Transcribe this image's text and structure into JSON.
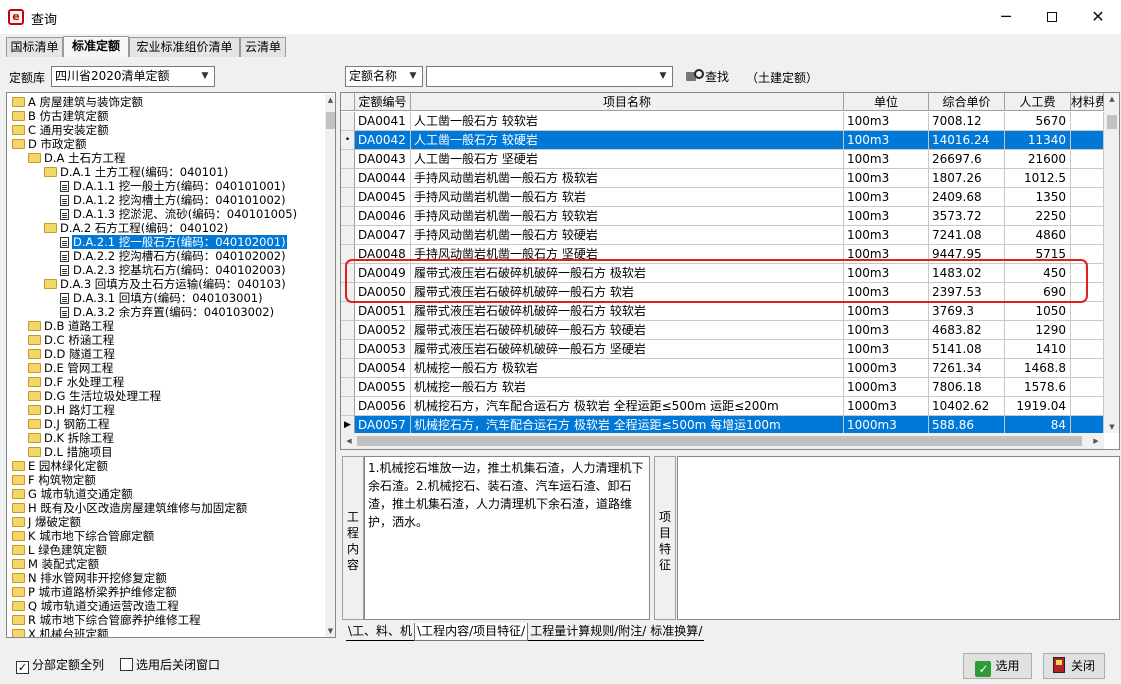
{
  "window": {
    "title": "查询",
    "icon": "app-logo-icon"
  },
  "top_tabs": [
    {
      "label": "国标清单",
      "active": false
    },
    {
      "label": "标准定额",
      "active": true
    },
    {
      "label": "宏业标准组价清单",
      "active": false
    },
    {
      "label": "云清单",
      "active": false
    }
  ],
  "filters": {
    "library_label": "定额库",
    "library_value": "四川省2020清单定额",
    "search_field_value": "定额名称",
    "search_input_value": "",
    "find_button_label": "查找",
    "scope_text": "（土建定额）"
  },
  "tree": [
    {
      "label": "A 房屋建筑与装饰定额",
      "indent": 0,
      "icon": "folder",
      "selected": false
    },
    {
      "label": "B 仿古建筑定额",
      "indent": 0,
      "icon": "folder",
      "selected": false
    },
    {
      "label": "C 通用安装定额",
      "indent": 0,
      "icon": "folder",
      "selected": false
    },
    {
      "label": "D 市政定额",
      "indent": 0,
      "icon": "folder",
      "selected": false
    },
    {
      "label": "D.A 土石方工程",
      "indent": 1,
      "icon": "folder",
      "selected": false
    },
    {
      "label": "D.A.1 土方工程(编码：040101)",
      "indent": 2,
      "icon": "folder",
      "selected": false
    },
    {
      "label": "D.A.1.1 挖一般土方(编码：040101001)",
      "indent": 3,
      "icon": "doc",
      "selected": false
    },
    {
      "label": "D.A.1.2 挖沟槽土方(编码：040101002)",
      "indent": 3,
      "icon": "doc",
      "selected": false
    },
    {
      "label": "D.A.1.3 挖淤泥、流砂(编码：040101005)",
      "indent": 3,
      "icon": "doc",
      "selected": false
    },
    {
      "label": "D.A.2 石方工程(编码：040102)",
      "indent": 2,
      "icon": "folder",
      "selected": false
    },
    {
      "label": "D.A.2.1 挖一般石方(编码：040102001)",
      "indent": 3,
      "icon": "doc",
      "selected": true
    },
    {
      "label": "D.A.2.2 挖沟槽石方(编码：040102002)",
      "indent": 3,
      "icon": "doc",
      "selected": false
    },
    {
      "label": "D.A.2.3 挖基坑石方(编码：040102003)",
      "indent": 3,
      "icon": "doc",
      "selected": false
    },
    {
      "label": "D.A.3 回填方及土石方运输(编码：040103)",
      "indent": 2,
      "icon": "folder",
      "selected": false
    },
    {
      "label": "D.A.3.1 回填方(编码：040103001)",
      "indent": 3,
      "icon": "doc",
      "selected": false
    },
    {
      "label": "D.A.3.2 余方弃置(编码：040103002)",
      "indent": 3,
      "icon": "doc",
      "selected": false
    },
    {
      "label": "D.B 道路工程",
      "indent": 1,
      "icon": "folder",
      "selected": false
    },
    {
      "label": "D.C 桥涵工程",
      "indent": 1,
      "icon": "folder",
      "selected": false
    },
    {
      "label": "D.D 隧道工程",
      "indent": 1,
      "icon": "folder",
      "selected": false
    },
    {
      "label": "D.E 管网工程",
      "indent": 1,
      "icon": "folder",
      "selected": false
    },
    {
      "label": "D.F 水处理工程",
      "indent": 1,
      "icon": "folder",
      "selected": false
    },
    {
      "label": "D.G 生活垃圾处理工程",
      "indent": 1,
      "icon": "folder",
      "selected": false
    },
    {
      "label": "D.H 路灯工程",
      "indent": 1,
      "icon": "folder",
      "selected": false
    },
    {
      "label": "D.J 钢筋工程",
      "indent": 1,
      "icon": "folder",
      "selected": false
    },
    {
      "label": "D.K 拆除工程",
      "indent": 1,
      "icon": "folder",
      "selected": false
    },
    {
      "label": "D.L 措施项目",
      "indent": 1,
      "icon": "folder",
      "selected": false
    },
    {
      "label": "E 园林绿化定额",
      "indent": 0,
      "icon": "folder",
      "selected": false
    },
    {
      "label": "F 构筑物定额",
      "indent": 0,
      "icon": "folder",
      "selected": false
    },
    {
      "label": "G 城市轨道交通定额",
      "indent": 0,
      "icon": "folder",
      "selected": false
    },
    {
      "label": "H 既有及小区改造房屋建筑维修与加固定额",
      "indent": 0,
      "icon": "folder",
      "selected": false
    },
    {
      "label": "J 爆破定额",
      "indent": 0,
      "icon": "folder",
      "selected": false
    },
    {
      "label": "K 城市地下综合管廊定额",
      "indent": 0,
      "icon": "folder",
      "selected": false
    },
    {
      "label": "L 绿色建筑定额",
      "indent": 0,
      "icon": "folder",
      "selected": false
    },
    {
      "label": "M 装配式定额",
      "indent": 0,
      "icon": "folder",
      "selected": false
    },
    {
      "label": "N 排水管网非开挖修复定额",
      "indent": 0,
      "icon": "folder",
      "selected": false
    },
    {
      "label": "P 城市道路桥梁养护维修定额",
      "indent": 0,
      "icon": "folder",
      "selected": false
    },
    {
      "label": "Q 城市轨道交通运营改造工程",
      "indent": 0,
      "icon": "folder",
      "selected": false
    },
    {
      "label": "R 城市地下综合管廊养护维修工程",
      "indent": 0,
      "icon": "folder",
      "selected": false
    },
    {
      "label": "X 机械台班定额",
      "indent": 0,
      "icon": "folder",
      "selected": false
    }
  ],
  "grid": {
    "columns": [
      "定额编号",
      "项目名称",
      "单位",
      "综合单价",
      "人工费",
      "材料费"
    ],
    "rows": [
      {
        "code": "DA0041",
        "name": "人工凿一般石方 较软岩",
        "unit": "100m3",
        "price": "7008.12",
        "labor": "5670",
        "selected": false,
        "indicator": ""
      },
      {
        "code": "DA0042",
        "name": "人工凿一般石方 较硬岩",
        "unit": "100m3",
        "price": "14016.24",
        "labor": "11340",
        "selected": true,
        "indicator": "•"
      },
      {
        "code": "DA0043",
        "name": "人工凿一般石方 坚硬岩",
        "unit": "100m3",
        "price": "26697.6",
        "labor": "21600",
        "selected": false,
        "indicator": ""
      },
      {
        "code": "DA0044",
        "name": "手持风动凿岩机凿一般石方 极软岩",
        "unit": "100m3",
        "price": "1807.26",
        "labor": "1012.5",
        "selected": false,
        "indicator": ""
      },
      {
        "code": "DA0045",
        "name": "手持风动凿岩机凿一般石方 软岩",
        "unit": "100m3",
        "price": "2409.68",
        "labor": "1350",
        "selected": false,
        "indicator": ""
      },
      {
        "code": "DA0046",
        "name": "手持风动凿岩机凿一般石方 较软岩",
        "unit": "100m3",
        "price": "3573.72",
        "labor": "2250",
        "selected": false,
        "indicator": ""
      },
      {
        "code": "DA0047",
        "name": "手持风动凿岩机凿一般石方 较硬岩",
        "unit": "100m3",
        "price": "7241.08",
        "labor": "4860",
        "selected": false,
        "indicator": ""
      },
      {
        "code": "DA0048",
        "name": "手持风动凿岩机凿一般石方 坚硬岩",
        "unit": "100m3",
        "price": "9447.95",
        "labor": "5715",
        "selected": false,
        "indicator": ""
      },
      {
        "code": "DA0049",
        "name": "履带式液压岩石破碎机破碎一般石方 极软岩",
        "unit": "100m3",
        "price": "1483.02",
        "labor": "450",
        "selected": false,
        "indicator": ""
      },
      {
        "code": "DA0050",
        "name": "履带式液压岩石破碎机破碎一般石方 软岩",
        "unit": "100m3",
        "price": "2397.53",
        "labor": "690",
        "selected": false,
        "indicator": ""
      },
      {
        "code": "DA0051",
        "name": "履带式液压岩石破碎机破碎一般石方 较软岩",
        "unit": "100m3",
        "price": "3769.3",
        "labor": "1050",
        "selected": false,
        "indicator": ""
      },
      {
        "code": "DA0052",
        "name": "履带式液压岩石破碎机破碎一般石方 较硬岩",
        "unit": "100m3",
        "price": "4683.82",
        "labor": "1290",
        "selected": false,
        "indicator": ""
      },
      {
        "code": "DA0053",
        "name": "履带式液压岩石破碎机破碎一般石方 坚硬岩",
        "unit": "100m3",
        "price": "5141.08",
        "labor": "1410",
        "selected": false,
        "indicator": ""
      },
      {
        "code": "DA0054",
        "name": "机械挖一般石方 极软岩",
        "unit": "1000m3",
        "price": "7261.34",
        "labor": "1468.8",
        "selected": false,
        "indicator": ""
      },
      {
        "code": "DA0055",
        "name": "机械挖一般石方 软岩",
        "unit": "1000m3",
        "price": "7806.18",
        "labor": "1578.6",
        "selected": false,
        "indicator": ""
      },
      {
        "code": "DA0056",
        "name": "机械挖石方，汽车配合运石方 极软岩 全程运距≤500m 运距≤200m",
        "unit": "1000m3",
        "price": "10402.62",
        "labor": "1919.04",
        "selected": false,
        "indicator": ""
      },
      {
        "code": "DA0057",
        "name": "机械挖石方，汽车配合运石方 极软岩 全程运距≤500m 每增运100m",
        "unit": "1000m3",
        "price": "588.86",
        "labor": "84",
        "selected": true,
        "indicator": "▶"
      }
    ]
  },
  "work_content": {
    "label": "工程内容",
    "text": "1.机械挖石堆放一边，推土机集石渣，人力清理机下余石渣。2.机械挖石、装石渣、汽车运石渣、卸石渣，推土机集石渣，人力清理机下余石渣，道路维护，洒水。"
  },
  "item_features": {
    "label": "项目特征",
    "text": ""
  },
  "bottom_tabs": [
    {
      "label": "工、料、机",
      "active": false
    },
    {
      "label": "工程内容/项目特征",
      "active": true
    },
    {
      "label": "工程量计算规则/附注",
      "active": false
    },
    {
      "label": "标准换算",
      "active": false
    }
  ],
  "footer": {
    "show_all_label": "分部定额全列",
    "show_all_checked": true,
    "close_after_select_label": "选用后关闭窗口",
    "close_after_select_checked": false,
    "select_button_label": "选用",
    "close_button_label": "关闭"
  }
}
